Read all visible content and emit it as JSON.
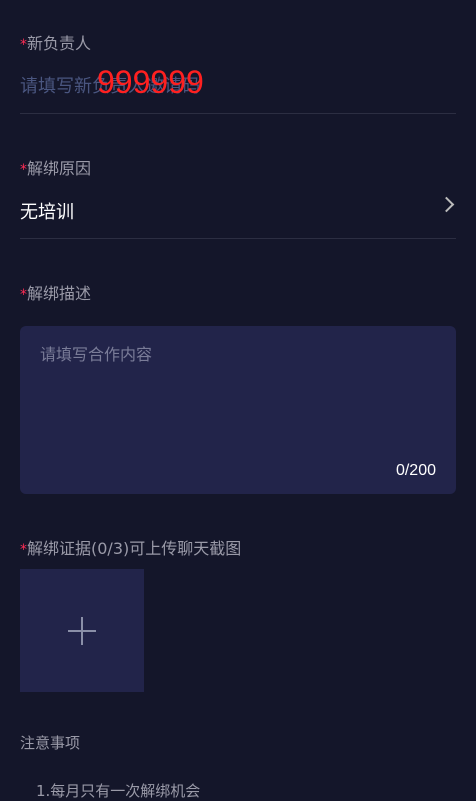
{
  "required_mark": "*",
  "new_owner": {
    "label": "新负责人",
    "placeholder": "请填写新负责人邀请码",
    "value": "999999"
  },
  "reason": {
    "label": "解绑原因",
    "value": "无培训"
  },
  "description": {
    "label": "解绑描述",
    "placeholder": "请填写合作内容",
    "counter": "0/200"
  },
  "evidence": {
    "label": "解绑证据(0/3)可上传聊天截图"
  },
  "notes": {
    "title": "注意事项",
    "items": [
      "1.每月只有一次解绑机会"
    ]
  }
}
